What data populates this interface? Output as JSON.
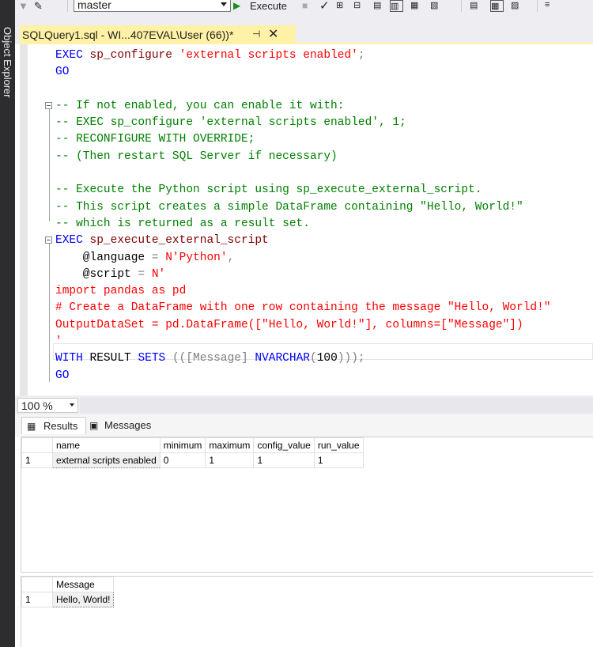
{
  "toolbar": {
    "database": "master",
    "execute_label": "Execute"
  },
  "side_panel": {
    "label": "Object Explorer"
  },
  "document_tab": {
    "title": "SQLQuery1.sql - WI...407EVAL\\User (66))*"
  },
  "editor": {
    "lines": [
      [
        {
          "t": "EXEC ",
          "c": "kw"
        },
        {
          "t": "sp_configure ",
          "c": "fn"
        },
        {
          "t": "'external scripts enabled'",
          "c": "str"
        },
        {
          "t": ";",
          "c": "gr"
        }
      ],
      [
        {
          "t": "GO",
          "c": "kw"
        }
      ],
      [],
      [
        {
          "t": "-- If not enabled, you can enable it with:",
          "c": "cm"
        }
      ],
      [
        {
          "t": "-- EXEC sp_configure 'external scripts enabled', 1;",
          "c": "cm"
        }
      ],
      [
        {
          "t": "-- RECONFIGURE WITH OVERRIDE;",
          "c": "cm"
        }
      ],
      [
        {
          "t": "-- (Then restart SQL Server if necessary)",
          "c": "cm"
        }
      ],
      [],
      [
        {
          "t": "-- Execute the Python script using sp_execute_external_script.",
          "c": "cm"
        }
      ],
      [
        {
          "t": "-- This script creates a simple DataFrame containing \"Hello, World!\"",
          "c": "cm"
        }
      ],
      [
        {
          "t": "-- which is returned as a result set.",
          "c": "cm"
        }
      ],
      [
        {
          "t": "EXEC ",
          "c": "kw"
        },
        {
          "t": "sp_execute_external_script",
          "c": "fn"
        }
      ],
      [
        {
          "t": "    @language ",
          "c": "pl"
        },
        {
          "t": "= ",
          "c": "gr"
        },
        {
          "t": "N'Python'",
          "c": "str"
        },
        {
          "t": ",",
          "c": "gr"
        }
      ],
      [
        {
          "t": "    @script ",
          "c": "pl"
        },
        {
          "t": "= ",
          "c": "gr"
        },
        {
          "t": "N'",
          "c": "str"
        }
      ],
      [
        {
          "t": "import pandas as pd",
          "c": "str"
        }
      ],
      [
        {
          "t": "# Create a DataFrame with one row containing the message \"Hello, World!\"",
          "c": "str"
        }
      ],
      [
        {
          "t": "OutputDataSet = pd.DataFrame([\"Hello, World!\"], columns=[\"Message\"])",
          "c": "str"
        }
      ],
      [
        {
          "t": "'",
          "c": "str"
        }
      ],
      [
        {
          "t": "WITH ",
          "c": "kw"
        },
        {
          "t": "RESULT ",
          "c": "pl"
        },
        {
          "t": "SETS ",
          "c": "kw"
        },
        {
          "t": "(([Message] ",
          "c": "gr"
        },
        {
          "t": "NVARCHAR",
          "c": "kw"
        },
        {
          "t": "(",
          "c": "gr"
        },
        {
          "t": "100",
          "c": "pl"
        },
        {
          "t": ")));",
          "c": "gr"
        }
      ],
      [
        {
          "t": "GO",
          "c": "kw"
        }
      ]
    ]
  },
  "zoom": {
    "value": "100 %"
  },
  "results_tabs": {
    "results_label": "Results",
    "messages_label": "Messages"
  },
  "grid1": {
    "columns": [
      "name",
      "minimum",
      "maximum",
      "config_value",
      "run_value"
    ],
    "rows": [
      {
        "num": "1",
        "cells": [
          "external scripts enabled",
          "0",
          "1",
          "1",
          "1"
        ]
      }
    ]
  },
  "grid2": {
    "columns": [
      "Message"
    ],
    "rows": [
      {
        "num": "1",
        "cells": [
          "Hello, World!"
        ]
      }
    ]
  }
}
